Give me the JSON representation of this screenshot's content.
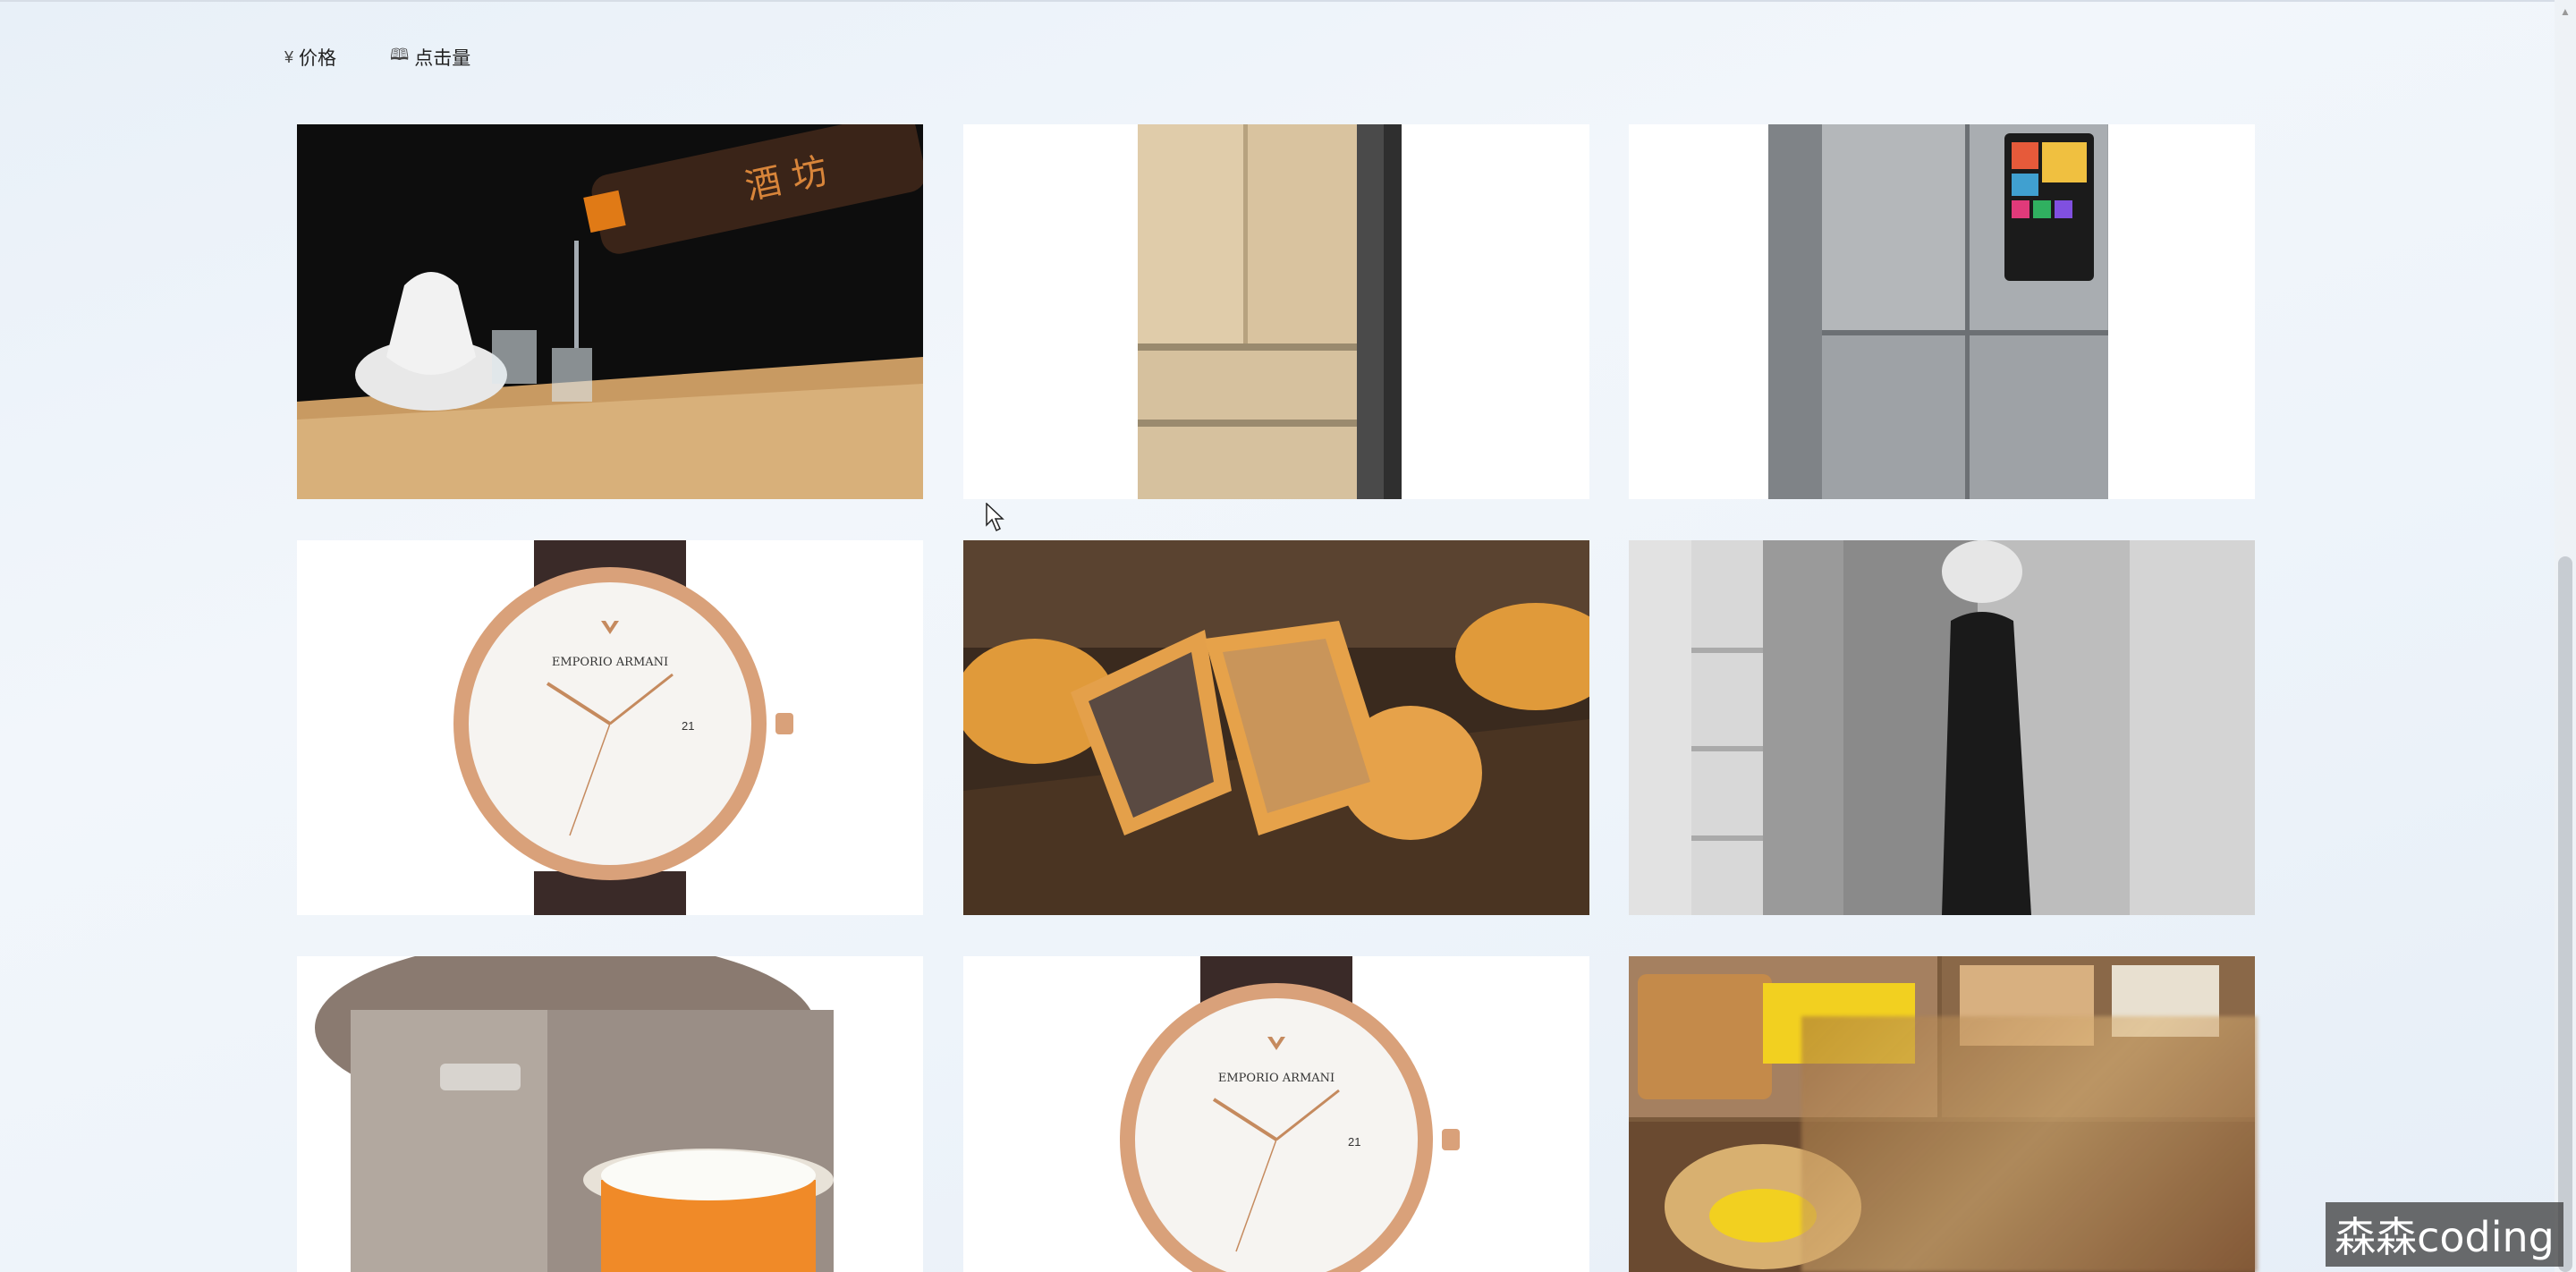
{
  "sort_options": [
    {
      "icon": "¥",
      "label": "价格"
    },
    {
      "icon": "🕮",
      "label": "点击量"
    }
  ],
  "products": [
    {
      "name": "baijiu-liquor"
    },
    {
      "name": "champagne-fridge"
    },
    {
      "name": "smart-fridge"
    },
    {
      "name": "rose-gold-watch"
    },
    {
      "name": "mooncakes"
    },
    {
      "name": "fashion-interior"
    },
    {
      "name": "rice-cooker"
    },
    {
      "name": "rose-gold-watch-2"
    },
    {
      "name": "snack-jars"
    }
  ],
  "watermark": "森森coding",
  "colors": {
    "accent": "#e07a16",
    "watch_gold": "#d9a17a",
    "fridge_champagne": "#d6c19e"
  }
}
